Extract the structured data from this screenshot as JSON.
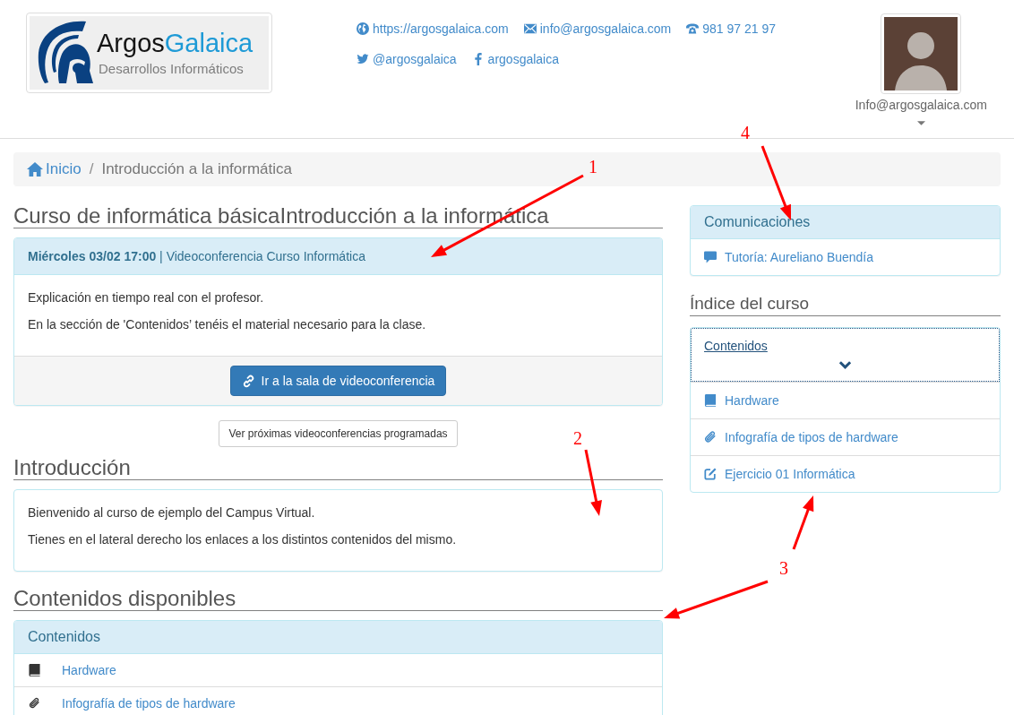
{
  "header": {
    "logo": {
      "brand_first": "Argos",
      "brand_second": "Galaica",
      "tagline": "Desarrollos Informáticos"
    },
    "contact_rows": [
      {
        "links": [
          {
            "kind": "web",
            "text": "https://argosgalaica.com"
          },
          {
            "kind": "email",
            "text": "info@argosgalaica.com"
          },
          {
            "kind": "phone",
            "text": "981 97 21 97"
          }
        ]
      },
      {
        "links": [
          {
            "kind": "twitter",
            "text": "@argosgalaica"
          },
          {
            "kind": "facebook",
            "text": "argosgalaica"
          }
        ]
      }
    ],
    "user_menu": {
      "name": "Info@argosgalaica.com"
    }
  },
  "breadcrumb": {
    "separator": "/",
    "items": [
      {
        "kind": "home",
        "label": "Inicio",
        "current": false
      },
      {
        "kind": "page",
        "label": "Introducción a la informática",
        "current": true
      }
    ]
  },
  "main": {
    "title": "Curso de informática básicaIntroducción a la informática",
    "videoconference": {
      "heading": "**Miércoles 03/02 17:00** | Videoconferencia Curso Informática",
      "paragraphs": [
        "Explicación en tiempo real con el profesor.",
        "En la sección de 'Contenidos’ tenéis el material necesario para la clase."
      ],
      "button": "Ir a la sala de videoconferencia"
    },
    "schedule_button": "Ver próximas videoconferencias programadas",
    "intro": {
      "title": "Introducción",
      "paragraphs": [
        "Bienvenido al curso de ejemplo del Campus Virtual.",
        "Tienes en el lateral derecho los enlaces a los distintos contenidos del mismo."
      ]
    },
    "contents": {
      "title": "Contenidos disponibles",
      "panel_title": "Contenidos",
      "items": [
        {
          "kind": "book",
          "label": "Hardware"
        },
        {
          "kind": "attachment",
          "label": "Infografía de tipos de hardware"
        }
      ]
    }
  },
  "sidebar": {
    "communications": {
      "title": "Comunicaciones",
      "items": [
        {
          "kind": "chat",
          "label": "Tutoría: Aureliano Buendía"
        }
      ]
    },
    "course_index": {
      "title": "Índice del curso",
      "sections": [
        {
          "label": "Contenidos",
          "expanded": true,
          "focused": true,
          "children": [
            {
              "kind": "book",
              "label": "Hardware"
            },
            {
              "kind": "attachment",
              "label": "Infografía de tipos de hardware"
            },
            {
              "kind": "exercise",
              "label": "Ejercicio 01 Informática"
            }
          ]
        }
      ]
    }
  },
  "annotations": [
    {
      "label": "1"
    },
    {
      "label": "2"
    },
    {
      "label": "3"
    },
    {
      "label": "4"
    }
  ]
}
